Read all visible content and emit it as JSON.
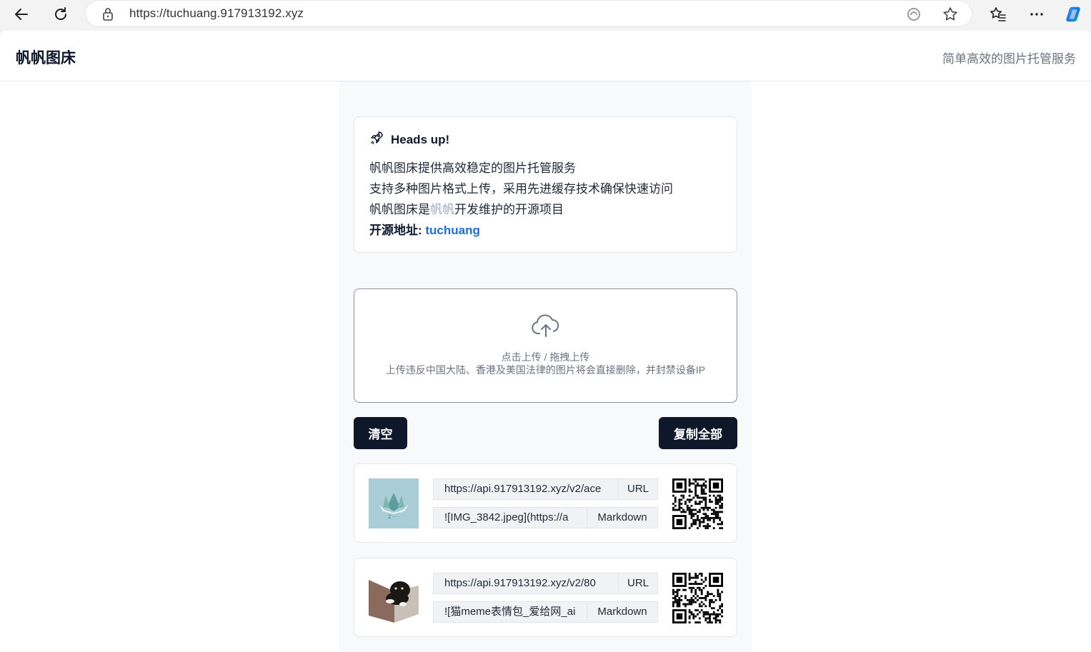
{
  "browser": {
    "url_host": "https://tuchuang.917913192.xyz",
    "back_icon": "back-arrow-icon",
    "reload_icon": "reload-icon"
  },
  "header": {
    "brand": "帆帆图床",
    "tagline": "简单高效的图片托管服务"
  },
  "alert": {
    "title": "Heads up!",
    "line1": "帆帆图床提供高效稳定的图片托管服务",
    "line2": "支持多种图片格式上传，采用先进缓存技术确保快速访问",
    "line3_prefix": "帆帆图床是",
    "line3_author": "帆帆",
    "line3_suffix": "开发维护的开源项目",
    "source_label": "开源地址: ",
    "source_link": "tuchuang"
  },
  "upload": {
    "hint": "点击上传 / 拖拽上传",
    "warning": "上传违反中国大陆、香港及美国法律的图片将会直接删除，并封禁设备IP"
  },
  "actions": {
    "clear": "清空",
    "copy_all": "复制全部"
  },
  "results": [
    {
      "url": "https://api.917913192.xyz/v2/ace",
      "url_tag": "URL",
      "markdown": "![IMG_3842.jpeg](https://a",
      "markdown_tag": "Markdown",
      "thumb": "logo-crystal-image"
    },
    {
      "url": "https://api.917913192.xyz/v2/80",
      "url_tag": "URL",
      "markdown": "![猫meme表情包_爱给网_ai",
      "markdown_tag": "Markdown",
      "thumb": "cat-laptop-image"
    }
  ],
  "colors": {
    "primary_button": "#0f172a",
    "link": "#1d6fd8",
    "author": "#9ca9c4"
  }
}
